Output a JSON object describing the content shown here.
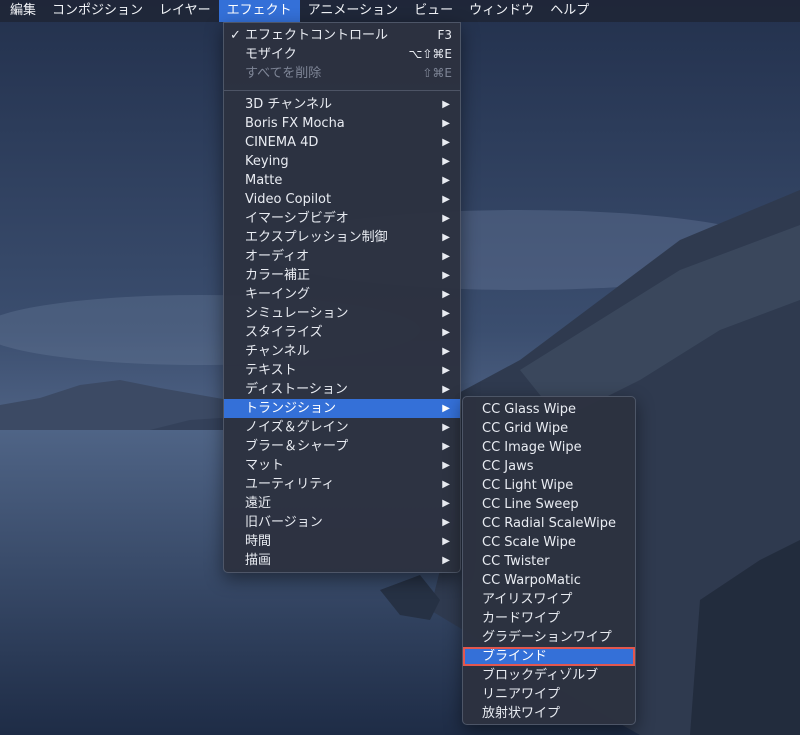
{
  "menubar": {
    "items": [
      "編集",
      "コンポジション",
      "レイヤー",
      "エフェクト",
      "アニメーション",
      "ビュー",
      "ウィンドウ",
      "ヘルプ"
    ],
    "active_index": 3
  },
  "effect_menu": {
    "top_items": [
      {
        "label": "エフェクトコントロール",
        "check": "✓",
        "shortcut": "F3",
        "enabled": true
      },
      {
        "label": "モザイク",
        "check": "",
        "shortcut": "⌥⇧⌘E",
        "enabled": true
      },
      {
        "label": "すべてを削除",
        "check": "",
        "shortcut": "⇧⌘E",
        "enabled": false
      }
    ],
    "categories": [
      "3D チャンネル",
      "Boris FX Mocha",
      "CINEMA 4D",
      "Keying",
      "Matte",
      "Video Copilot",
      "イマーシブビデオ",
      "エクスプレッション制御",
      "オーディオ",
      "カラー補正",
      "キーイング",
      "シミュレーション",
      "スタイライズ",
      "チャンネル",
      "テキスト",
      "ディストーション",
      "トランジション",
      "ノイズ＆グレイン",
      "ブラー＆シャープ",
      "マット",
      "ユーティリティ",
      "遠近",
      "旧バージョン",
      "時間",
      "描画"
    ],
    "highlighted_category": "トランジション",
    "submenu_arrow": "▶"
  },
  "transition_submenu": {
    "items": [
      "CC Glass Wipe",
      "CC Grid Wipe",
      "CC Image Wipe",
      "CC Jaws",
      "CC Light Wipe",
      "CC Line Sweep",
      "CC Radial ScaleWipe",
      "CC Scale Wipe",
      "CC Twister",
      "CC WarpoMatic",
      "アイリスワイプ",
      "カードワイプ",
      "グラデーションワイプ",
      "ブラインド",
      "ブロックディゾルブ",
      "リニアワイプ",
      "放射状ワイプ"
    ],
    "highlighted_item": "ブラインド"
  },
  "colors": {
    "highlight": "#3470d8",
    "annotation_box": "#e2574f"
  }
}
